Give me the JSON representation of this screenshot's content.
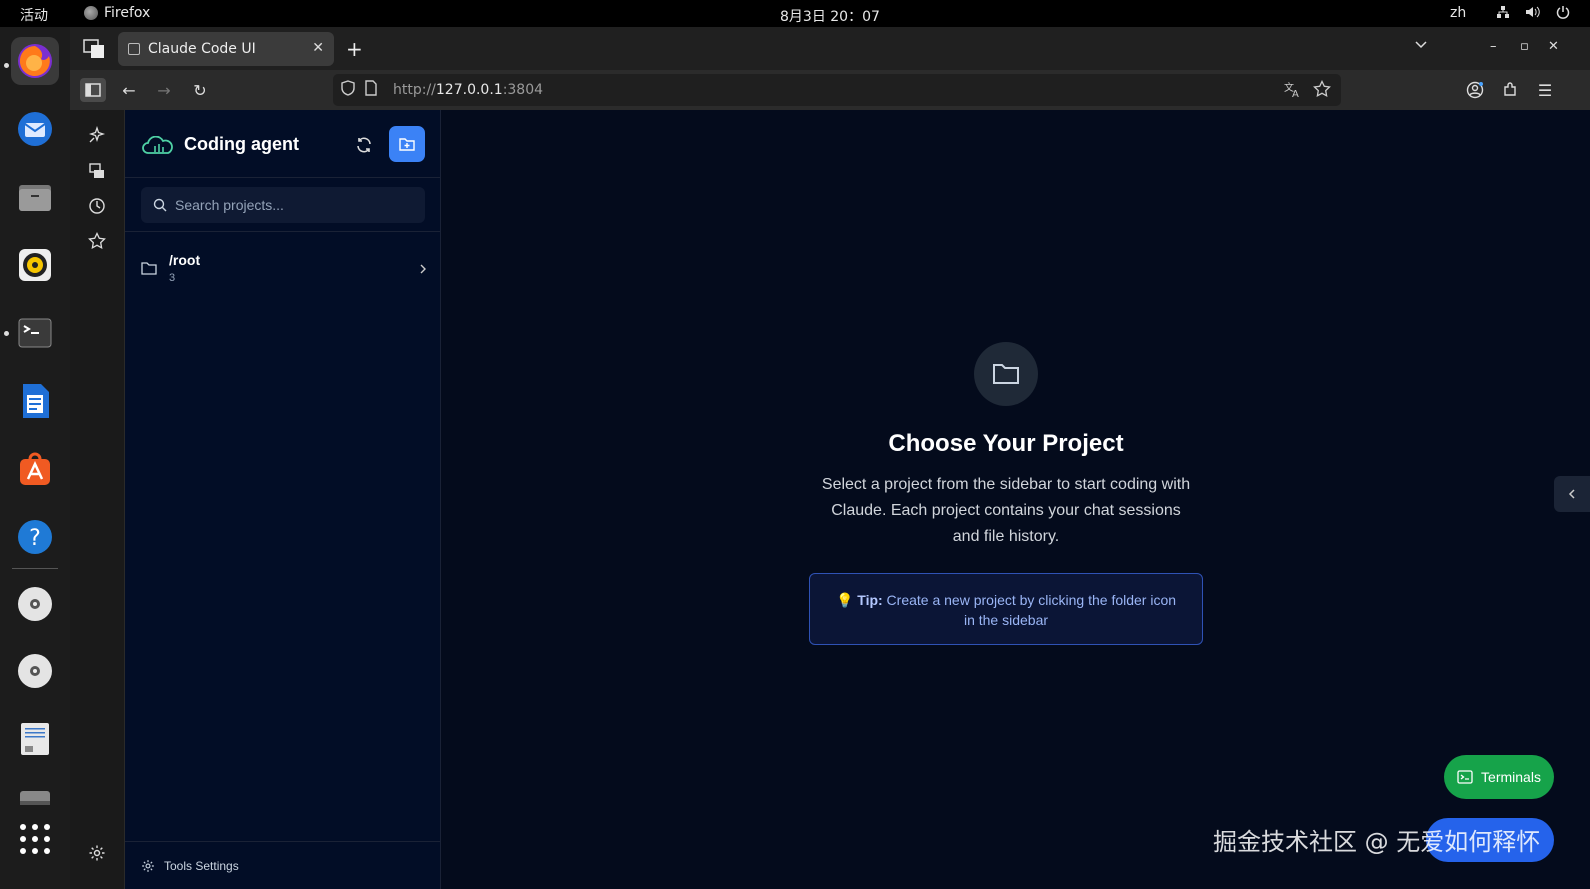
{
  "system": {
    "activities": "活动",
    "app_name": "Firefox",
    "clock": "8月3日 20：07",
    "lang": "zh"
  },
  "browser": {
    "tab_title": "Claude Code UI",
    "url_scheme": "http://",
    "url_host": "127.0.0.1",
    "url_port": ":3804"
  },
  "sidebar": {
    "title": "Coding agent",
    "search_placeholder": "Search projects...",
    "projects": [
      {
        "name": "/root",
        "count": "3"
      }
    ],
    "footer_label": "Tools Settings"
  },
  "main": {
    "title": "Choose Your Project",
    "description": "Select a project from the sidebar to start coding with Claude. Each project contains your chat sessions and file history.",
    "tip_emoji": "💡",
    "tip_label": "Tip:",
    "tip_text": " Create a new project by clicking the folder icon in the sidebar"
  },
  "floating": {
    "terminals_label": "Terminals"
  },
  "watermark": "掘金技术社区 @ 无爱如何释怀",
  "colors": {
    "accent_blue": "#3b82f6",
    "terminals_green": "#16a34a",
    "page_bg": "#040b1c",
    "sidebar_bg": "#020d26"
  }
}
